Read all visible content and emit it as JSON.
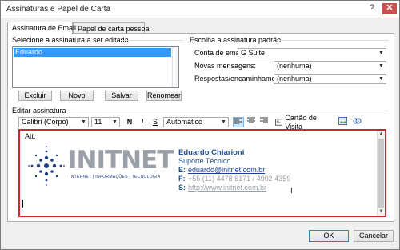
{
  "window": {
    "title": "Assinaturas e Papel de Carta",
    "help": "?",
    "close": "✕"
  },
  "tabs": [
    {
      "label": "Assinatura de Email"
    },
    {
      "label": "Papel de carta pessoal"
    }
  ],
  "select_signature": {
    "heading": "Selecione a assinatura a ser editada",
    "items": [
      "Eduardo"
    ],
    "buttons": {
      "delete": "Excluir",
      "new": "Novo",
      "save": "Salvar",
      "rename": "Renomear"
    }
  },
  "default_signature": {
    "heading": "Escolha a assinatura padrão",
    "account_label": "Conta de email:",
    "account_value": "G Suite",
    "new_messages_label": "Novas mensagens:",
    "new_messages_value": "(nenhuma)",
    "replies_label": "Respostas/encaminhamentos:",
    "replies_value": "(nenhuma)"
  },
  "edit_signature": {
    "heading": "Editar assinatura",
    "font": "Calibri (Corpo)",
    "size": "11",
    "bold": "N",
    "italic": "I",
    "underline": "S",
    "color": "Automático",
    "business_card": "Cartão de Visita"
  },
  "signature": {
    "greeting": "Att.",
    "logo_text": "INITNET",
    "logo_tagline": "INTERNET | INFORMAÇÕES | TECNOLOGIA",
    "name": "Eduardo Chiarioni",
    "role": "Suporte Técnico",
    "email_label": "E:",
    "email": "eduardo@initnet.com.br",
    "phone_label": "F:",
    "phone": "+55 (11) 4478 6171 / 4902 4359",
    "site_label": "S:",
    "site": "http://www.initnet.com.br"
  },
  "footer": {
    "ok": "OK",
    "cancel": "Cancelar"
  },
  "colors": {
    "accent_border": "#d0262e",
    "name_blue": "#1f4e8c",
    "link_blue": "#1a3e9b",
    "selection": "#3399ff"
  }
}
